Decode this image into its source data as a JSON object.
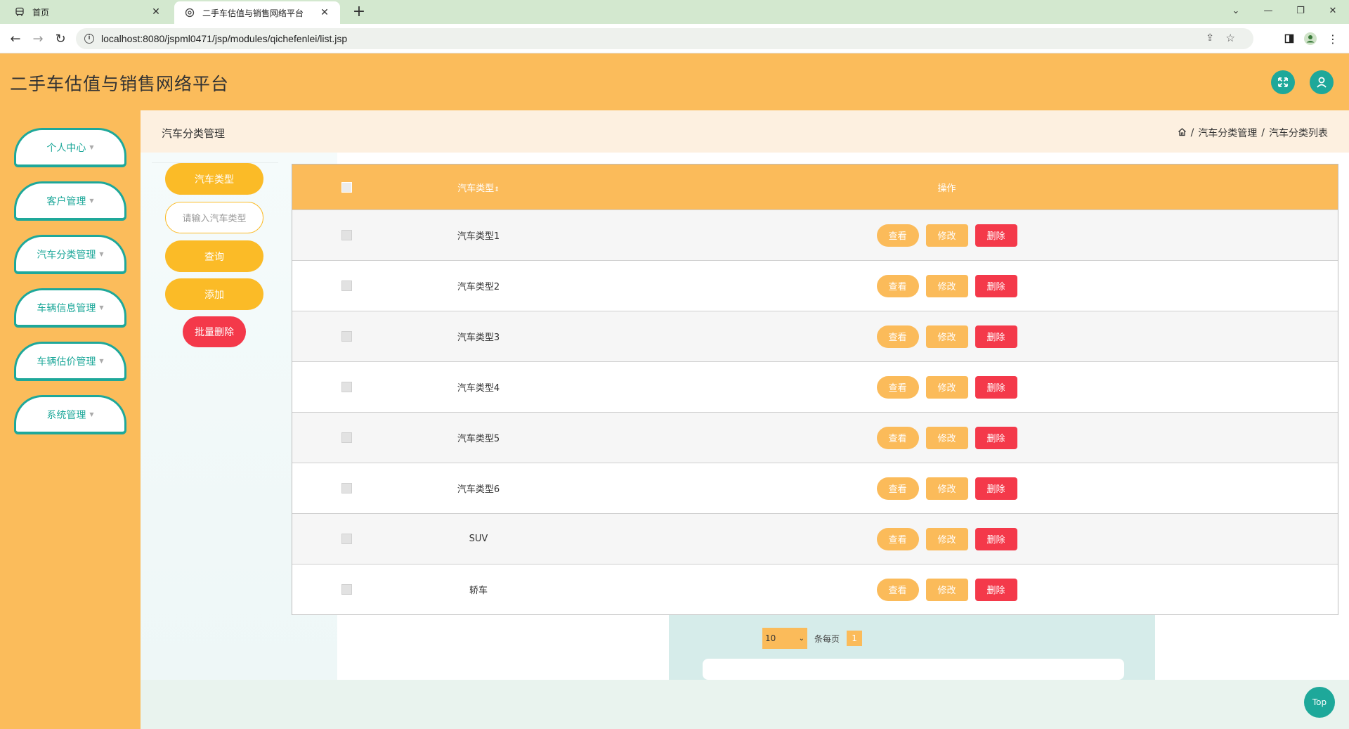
{
  "browser": {
    "tabs": [
      {
        "title": "首页"
      },
      {
        "title": "二手车估值与销售网络平台"
      }
    ],
    "url": "localhost:8080/jspml0471/jsp/modules/qichefenlei/list.jsp"
  },
  "app": {
    "title": "二手车估值与销售网络平台"
  },
  "sidebar": {
    "items": [
      {
        "label": "个人中心"
      },
      {
        "label": "客户管理"
      },
      {
        "label": "汽车分类管理"
      },
      {
        "label": "车辆信息管理"
      },
      {
        "label": "车辆估价管理"
      },
      {
        "label": "系统管理"
      }
    ]
  },
  "breadcrumb": {
    "page_title": "汽车分类管理",
    "path": [
      "汽车分类管理",
      "汽车分类列表"
    ],
    "sep": "/"
  },
  "search": {
    "field_label": "汽车类型",
    "placeholder": "请输入汽车类型",
    "query_label": "查询",
    "add_label": "添加",
    "batch_delete_label": "批量删除"
  },
  "table": {
    "col_type": "汽车类型",
    "col_ops": "操作",
    "rows": [
      {
        "type": "汽车类型1"
      },
      {
        "type": "汽车类型2"
      },
      {
        "type": "汽车类型3"
      },
      {
        "type": "汽车类型4"
      },
      {
        "type": "汽车类型5"
      },
      {
        "type": "汽车类型6"
      },
      {
        "type": "SUV"
      },
      {
        "type": "轿车"
      }
    ],
    "view_label": "查看",
    "edit_label": "修改",
    "delete_label": "删除"
  },
  "pager": {
    "page_size": "10",
    "per_page_label": "条每页",
    "current_page": "1"
  },
  "top_label": "Top",
  "colors": {
    "header_bg": "#fbbc5b",
    "accent_teal": "#1ea89a",
    "button_yellow": "#fbbb27",
    "danger_red": "#f4394a"
  }
}
